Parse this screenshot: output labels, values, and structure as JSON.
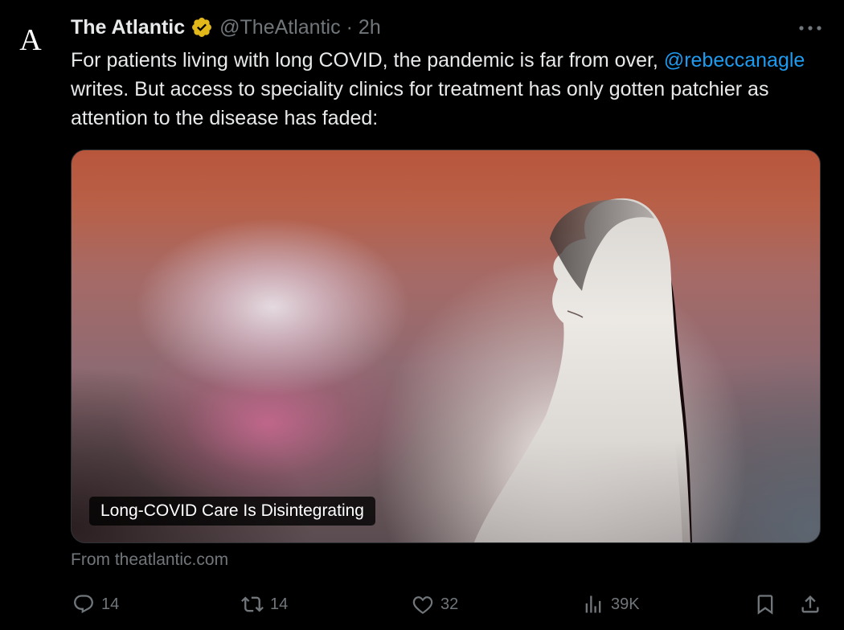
{
  "tweet": {
    "avatar_letter": "A",
    "display_name": "The Atlantic",
    "handle": "@TheAtlantic",
    "separator": "·",
    "time": "2h",
    "text_part1": "For patients living with long COVID, the pandemic is far from over, ",
    "mention": "@rebeccanagle",
    "text_part2": " writes. But access to speciality clinics for treatment has only gotten patchier as attention to the disease has faded:"
  },
  "card": {
    "title": "Long-COVID Care Is Disintegrating",
    "source": "From theatlantic.com"
  },
  "actions": {
    "replies": "14",
    "reposts": "14",
    "likes": "32",
    "views": "39K"
  },
  "colors": {
    "background": "#000000",
    "text": "#e7e9ea",
    "muted": "#71767b",
    "link": "#1d9bf0",
    "verified_badge": "#e2b719"
  },
  "icons": [
    "reply-icon",
    "repost-icon",
    "like-icon",
    "views-icon",
    "bookmark-icon",
    "share-icon",
    "more-icon",
    "verified-badge-icon"
  ]
}
